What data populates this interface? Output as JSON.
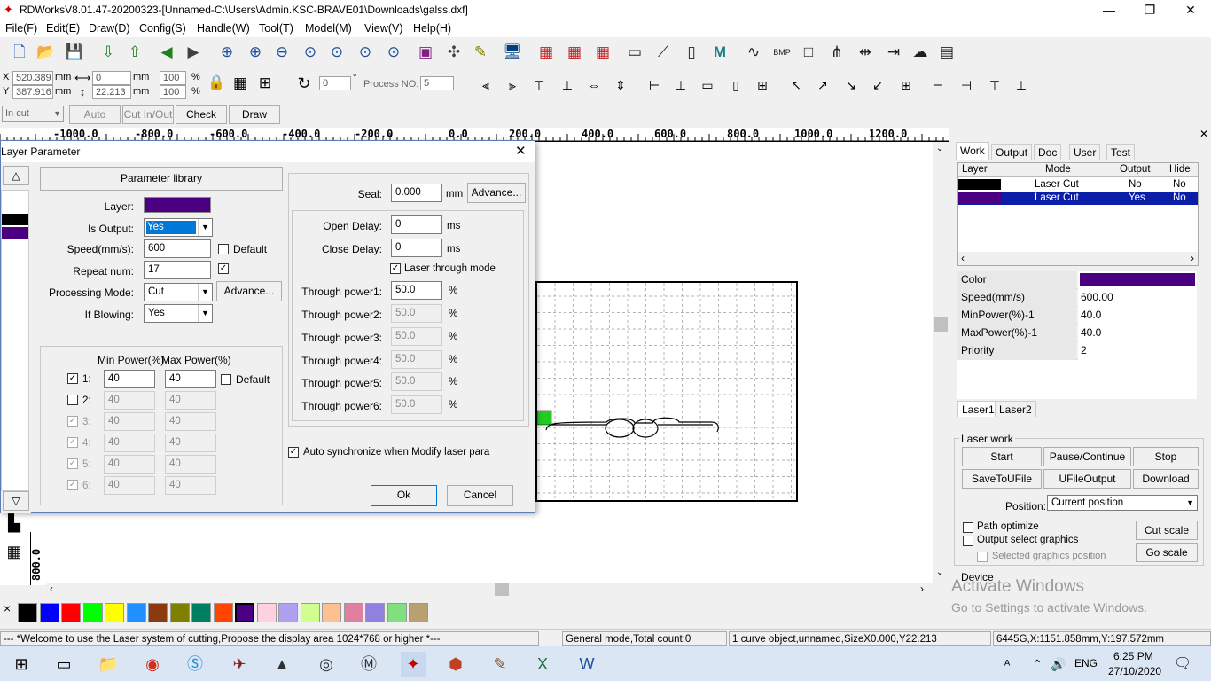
{
  "app": {
    "title": "RDWorksV8.01.47-20200323-[Unnamed-C:\\Users\\Admin.KSC-BRAVE01\\Downloads\\galss.dxf]"
  },
  "window_controls": {
    "minimize": "—",
    "maximize": "❐",
    "close": "✕"
  },
  "menu": [
    "File(F)",
    "Edit(E)",
    "Draw(D)",
    "Config(S)",
    "Handle(W)",
    "Tool(T)",
    "Model(M)",
    "View(V)",
    "Help(H)"
  ],
  "coords": {
    "x_label": "X",
    "x_value": "520.389",
    "y_label": "Y",
    "y_value": "387.916",
    "unit_mm": "mm",
    "w_value": "0",
    "h_value": "22.213",
    "pct_x": "100",
    "pct_y": "100",
    "pct": "%",
    "rot_value": "0",
    "deg": "°",
    "process_no_label": "Process NO:",
    "process_no_value": "5"
  },
  "toolbar3": {
    "mode_select": "In cut",
    "auto": "Auto",
    "cut_inout": "Cut In/Out",
    "check": "Check",
    "draw": "Draw"
  },
  "ruler": [
    "-1000.0",
    "-800.0",
    "-600.0",
    "-400.0",
    "-200.0",
    "0.0",
    "200.0",
    "400.0",
    "600.0",
    "800.0",
    "1000.0",
    "1200.0"
  ],
  "vruler_label": "800.0",
  "dialog": {
    "title": "Layer Parameter",
    "param_library": "Parameter library",
    "layer_label": "Layer:",
    "layer_color": "#4b0082",
    "is_output_label": "Is Output:",
    "is_output_value": "Yes",
    "speed_label": "Speed(mm/s):",
    "speed_value": "600",
    "default_label": "Default",
    "repeat_label": "Repeat num:",
    "repeat_value": "17",
    "processing_label": "Processing Mode:",
    "processing_value": "Cut",
    "advance_label": "Advance...",
    "blowing_label": "If Blowing:",
    "blowing_value": "Yes",
    "min_power_header": "Min Power(%)",
    "max_power_header": "Max Power(%)",
    "power_default": "Default",
    "power_rows": [
      {
        "label": "1:",
        "min": "40",
        "max": "40"
      },
      {
        "label": "2:",
        "min": "40",
        "max": "40"
      },
      {
        "label": "3:",
        "min": "40",
        "max": "40"
      },
      {
        "label": "4:",
        "min": "40",
        "max": "40"
      },
      {
        "label": "5:",
        "min": "40",
        "max": "40"
      },
      {
        "label": "6:",
        "min": "40",
        "max": "40"
      }
    ],
    "seal_label": "Seal:",
    "seal_value": "0.000",
    "seal_unit": "mm",
    "seal_advance": "Advance...",
    "open_delay_label": "Open Delay:",
    "open_delay_value": "0",
    "close_delay_label": "Close Delay:",
    "close_delay_value": "0",
    "ms": "ms",
    "laser_through_label": "Laser through mode",
    "through_powers": [
      {
        "label": "Through power1:",
        "value": "50.0"
      },
      {
        "label": "Through power2:",
        "value": "50.0"
      },
      {
        "label": "Through power3:",
        "value": "50.0"
      },
      {
        "label": "Through power4:",
        "value": "50.0"
      },
      {
        "label": "Through power5:",
        "value": "50.0"
      },
      {
        "label": "Through power6:",
        "value": "50.0"
      }
    ],
    "pct": "%",
    "auto_sync_label": "Auto synchronize when Modify laser para",
    "ok": "Ok",
    "cancel": "Cancel"
  },
  "right_panel": {
    "tabs": [
      "Work",
      "Output",
      "Doc",
      "User",
      "Test"
    ],
    "layer_headers": [
      "Layer",
      "Mode",
      "Output",
      "Hide"
    ],
    "layers": [
      {
        "color": "#000000",
        "mode": "Laser Cut",
        "output": "No",
        "hide": "No"
      },
      {
        "color": "#4b0082",
        "mode": "Laser Cut",
        "output": "Yes",
        "hide": "No"
      }
    ],
    "props": [
      {
        "k": "Color",
        "v": ""
      },
      {
        "k": "Speed(mm/s)",
        "v": "600.00"
      },
      {
        "k": "MinPower(%)-1",
        "v": "40.0"
      },
      {
        "k": "MaxPower(%)-1",
        "v": "40.0"
      },
      {
        "k": "Priority",
        "v": "2"
      }
    ],
    "prop_color": "#4b0082",
    "laser_tabs": [
      "Laser1",
      "Laser2"
    ],
    "laser_work": "Laser work",
    "start": "Start",
    "pause": "Pause/Continue",
    "stop": "Stop",
    "save_to_ufile": "SaveToUFile",
    "ufile_output": "UFileOutput",
    "download": "Download",
    "position_label": "Position:",
    "position_value": "Current position",
    "path_optimize": "Path optimize",
    "output_select": "Output select graphics",
    "selected_pos": "Selected graphics position",
    "cut_scale": "Cut scale",
    "go_scale": "Go scale",
    "device": "Device",
    "watermark1": "Activate Windows",
    "watermark2": "Go to Settings to activate Windows."
  },
  "palette_colors": [
    "#000000",
    "#0000ff",
    "#ff0000",
    "#00ff00",
    "#ffff00",
    "#1e90ff",
    "#8b3a0f",
    "#808000",
    "#008060",
    "#ff4500",
    "#4b0082",
    "#ffd0e0",
    "#b0a0f0",
    "#d0ff90",
    "#ffc090",
    "#e080a0",
    "#9080e0",
    "#80e080",
    "#b8a070"
  ],
  "palette_close": "×",
  "status": {
    "welcome": "--- *Welcome to use the Laser system of cutting,Propose the display area 1024*768 or higher *---",
    "mode": "General mode,Total count:0",
    "object": "1 curve object,unnamed,SizeX0.000,Y22.213",
    "pos": "6445G,X:1151.858mm,Y:197.572mm"
  },
  "taskbar": {
    "lang": "ENG",
    "time": "6:25 PM",
    "date": "27/10/2020"
  }
}
